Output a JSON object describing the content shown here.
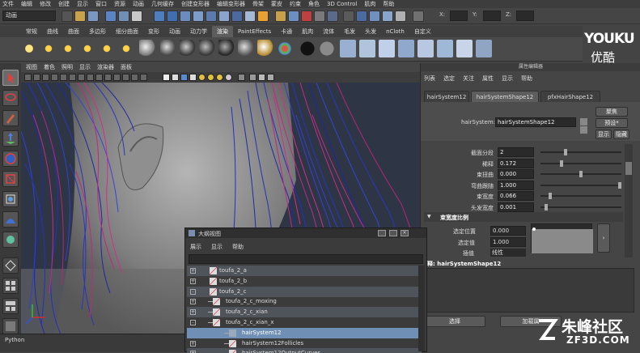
{
  "menubar": [
    "文件",
    "编辑",
    "修改",
    "创建",
    "显示",
    "窗口",
    "资源",
    "动画",
    "几何缓存",
    "创建变形器",
    "编辑变形器",
    "骨架",
    "蒙皮",
    "约束",
    "角色",
    "3D Control",
    "肌肉",
    "帮助"
  ],
  "status": {
    "mode": "动画",
    "x_label": "X:",
    "y_label": "Y:",
    "z_label": "Z:"
  },
  "shelf_tabs": [
    "常规",
    "曲线",
    "曲面",
    "多边形",
    "细分曲面",
    "变形",
    "动画",
    "动力学",
    "渲染",
    "PaintEffects",
    "卡通",
    "肌肉",
    "流体",
    "毛发",
    "头发",
    "nCloth",
    "自定义"
  ],
  "shelf_active": "渲染",
  "viewport_menu": [
    "视图",
    "着色",
    "照明",
    "显示",
    "渲染器",
    "面板"
  ],
  "python_label": "Python",
  "attribute_editor": {
    "title": "属性编辑器",
    "menu": [
      "列表",
      "选定",
      "关注",
      "属性",
      "显示",
      "帮助"
    ],
    "tabs": [
      "hairSystem12",
      "hairSystemShape12",
      "pfxHairShape12"
    ],
    "active_tab": "hairSystemShape12",
    "node_label": "hairSystem:",
    "node_value": "hairSystemShape12",
    "btn_focus": "聚焦",
    "btn_preset": "预设*",
    "btn_show": "显示",
    "btn_hide": "隐藏",
    "rows": [
      {
        "label": "截面分段",
        "value": "2",
        "slider": 0.3
      },
      {
        "label": "稀释",
        "value": "0.172",
        "slider": 0.25
      },
      {
        "label": "束扭曲",
        "value": "0.000",
        "slider": 0.5
      },
      {
        "label": "弯曲跟随",
        "value": "1.000",
        "slider": 1.0
      },
      {
        "label": "束宽度",
        "value": "0.066",
        "slider": 0.1
      },
      {
        "label": "头发宽度",
        "value": "0.001",
        "slider": 0.05
      }
    ],
    "section": "束宽度比例",
    "sel_pos_label": "选定位置",
    "sel_pos_value": "0.000",
    "sel_val_label": "选定值",
    "sel_val_value": "1.000",
    "interp_label": "插值",
    "interp_value": "线性",
    "notes": "释: hairSystemShape12",
    "btn_select": "选择",
    "btn_load": "加载属"
  },
  "outliner": {
    "title": "大纲视图",
    "menu": [
      "展示",
      "显示",
      "帮助"
    ],
    "items": [
      {
        "label": "toufa_2_a",
        "indent": 0,
        "exp": "+",
        "type": "curve"
      },
      {
        "label": "toufa_2_b",
        "indent": 0,
        "exp": "+",
        "type": "curve"
      },
      {
        "label": "toufa_2_c",
        "indent": 0,
        "exp": "-",
        "type": "curve"
      },
      {
        "label": "toufa_2_c_moxing",
        "indent": 1,
        "exp": "+",
        "type": "curve"
      },
      {
        "label": "toufa_2_c_xian",
        "indent": 1,
        "exp": "+",
        "type": "curve"
      },
      {
        "label": "toufa_2_c_xian_x",
        "indent": 1,
        "exp": "-",
        "type": "curve"
      },
      {
        "label": "hairSystem12",
        "indent": 2,
        "exp": "",
        "type": "hair"
      },
      {
        "label": "hairSystem12Follicles",
        "indent": 2,
        "exp": "+",
        "type": "curve"
      },
      {
        "label": "hairSystem12OutputCurves",
        "indent": 2,
        "exp": "+",
        "type": "curve"
      }
    ]
  },
  "watermarks": {
    "youku": "YOUKU",
    "youku_cn": "优酷",
    "site_cn": "朱峰社区",
    "site_en": "ZF3D.COM"
  }
}
